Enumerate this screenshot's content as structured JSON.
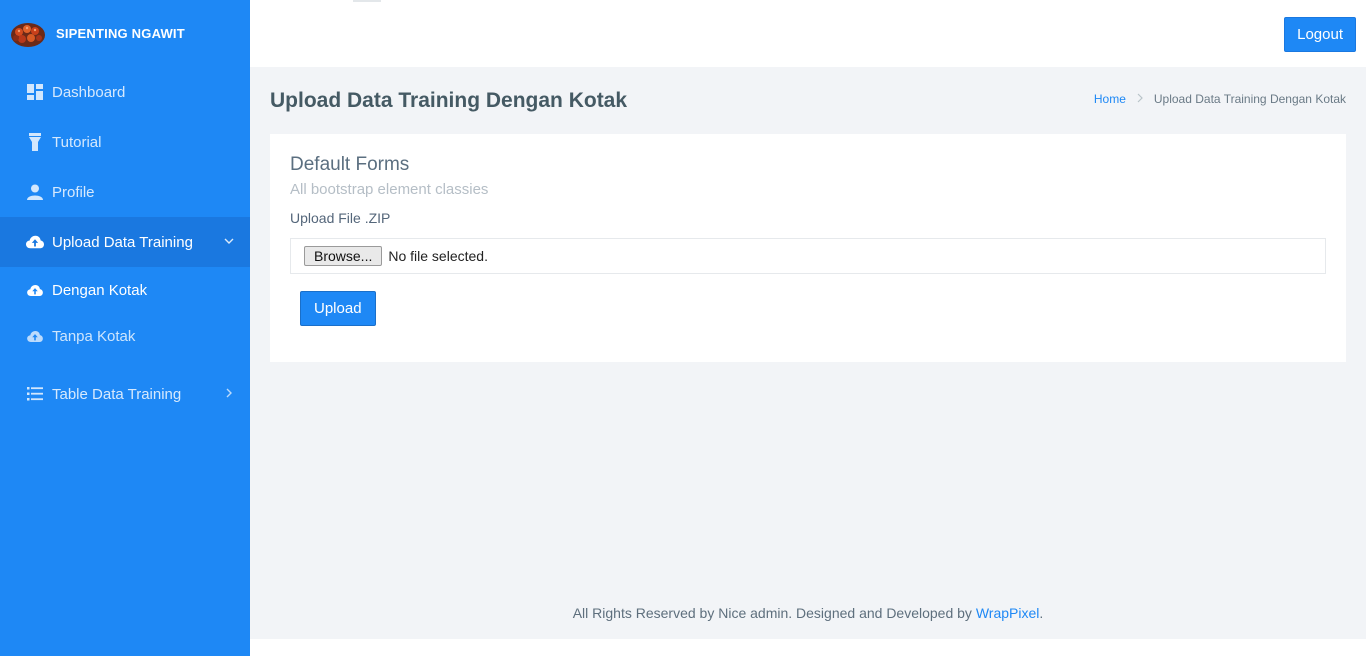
{
  "brand": {
    "name": "SIPENTING NGAWIT"
  },
  "sidebar": {
    "items": [
      {
        "label": "Dashboard",
        "icon": "dashboard-icon"
      },
      {
        "label": "Tutorial",
        "icon": "flashlight-icon"
      },
      {
        "label": "Profile",
        "icon": "user-icon"
      },
      {
        "label": "Upload Data Training",
        "icon": "cloud-upload-icon",
        "expanded": true
      },
      {
        "label": "Table Data Training",
        "icon": "list-icon",
        "expanded": false
      }
    ],
    "subitems": [
      {
        "label": "Dengan Kotak",
        "icon": "cloud-upload-icon",
        "active": true
      },
      {
        "label": "Tanpa Kotak",
        "icon": "cloud-upload-icon",
        "active": false
      }
    ]
  },
  "topbar": {
    "logout_label": "Logout"
  },
  "page": {
    "title": "Upload Data Training Dengan Kotak",
    "breadcrumb": {
      "home": "Home",
      "current": "Upload Data Training Dengan Kotak"
    }
  },
  "form": {
    "title": "Default Forms",
    "subtitle": "All bootstrap element classies",
    "file_label": "Upload File .ZIP",
    "browse_label": "Browse...",
    "file_status": "No file selected.",
    "submit_label": "Upload"
  },
  "footer": {
    "text": "All Rights Reserved by Nice admin. Designed and Developed by ",
    "link": "WrapPixel",
    "end": "."
  },
  "colors": {
    "primary": "#1e88f5",
    "background": "#f2f4f7"
  }
}
